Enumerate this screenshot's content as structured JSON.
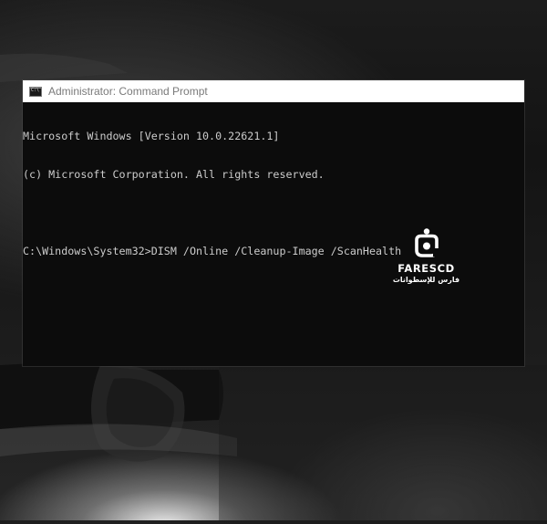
{
  "window": {
    "title": "Administrator: Command Prompt",
    "icon": "cmd-icon"
  },
  "console": {
    "lines": [
      "Microsoft Windows [Version 10.0.22621.1]",
      "(c) Microsoft Corporation. All rights reserved.",
      "",
      "C:\\Windows\\System32>DISM /Online /Cleanup-Image /ScanHealth"
    ],
    "text_color": "#cccccc",
    "background_color": "#0c0c0c"
  },
  "watermark": {
    "brand": "FARESCD",
    "subtitle": "فارس للإسطوانات",
    "icon": "faresCD-logo-icon"
  }
}
